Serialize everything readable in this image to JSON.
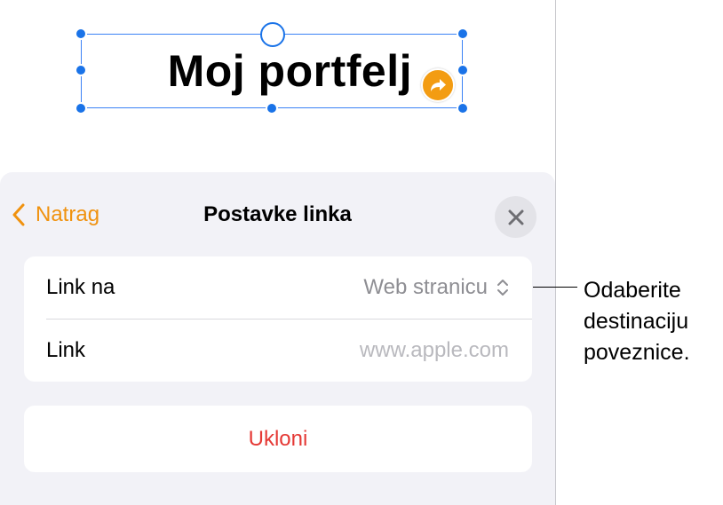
{
  "canvas": {
    "title": "Moj portfelj"
  },
  "sheet": {
    "back_label": "Natrag",
    "title": "Postavke linka",
    "rows": [
      {
        "label": "Link na",
        "value": "Web stranicu"
      },
      {
        "label": "Link",
        "placeholder": "www.apple.com"
      }
    ],
    "remove_label": "Ukloni"
  },
  "callout": {
    "lines": [
      "Odaberite",
      "destinaciju",
      "poveznice."
    ]
  },
  "colors": {
    "accent": "#f0920f",
    "selection": "#1a73e8",
    "destructive": "#e53935",
    "sheet_bg": "#f2f2f7"
  },
  "icons": {
    "back": "chevron-left-icon",
    "close": "close-icon",
    "link": "link-arrow-icon",
    "popup": "chevron-up-down-icon"
  }
}
